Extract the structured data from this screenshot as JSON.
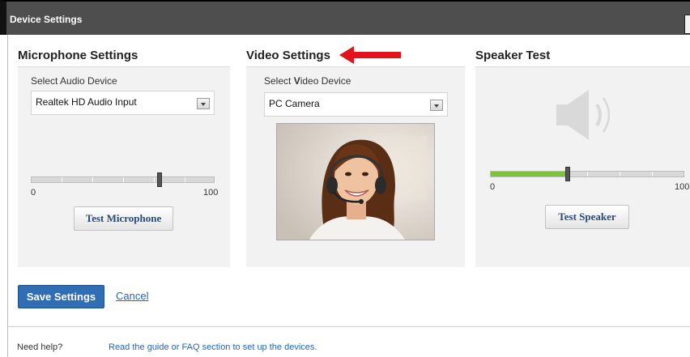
{
  "window": {
    "title": "Device Settings"
  },
  "microphone": {
    "title": "Microphone Settings",
    "select_label": "Select Audio Device",
    "device": "Realtek HD Audio Input",
    "volume": 70,
    "min": "0",
    "max": "100",
    "button": "Test Microphone"
  },
  "video": {
    "title": "Video Settings",
    "select_label_prefix": "Select ",
    "select_label_bold": "V",
    "select_label_suffix": "ideo Device",
    "device": "PC Camera"
  },
  "speaker": {
    "title": "Speaker Test",
    "volume": 40,
    "min": "0",
    "max": "100",
    "button": "Test Speaker"
  },
  "actions": {
    "save": "Save Settings",
    "cancel": "Cancel"
  },
  "help": {
    "label": "Need help?",
    "text": "Read the guide or FAQ section to set up the devices."
  },
  "icons": {
    "speaker": "speaker-icon",
    "arrow": "red-arrow-icon",
    "dropdown": "chevron-down-icon"
  },
  "colors": {
    "titlebar": "#4e4e4e",
    "accent": "#2f6db5",
    "level": "#7cc33b",
    "annotation": "#e2131b"
  }
}
